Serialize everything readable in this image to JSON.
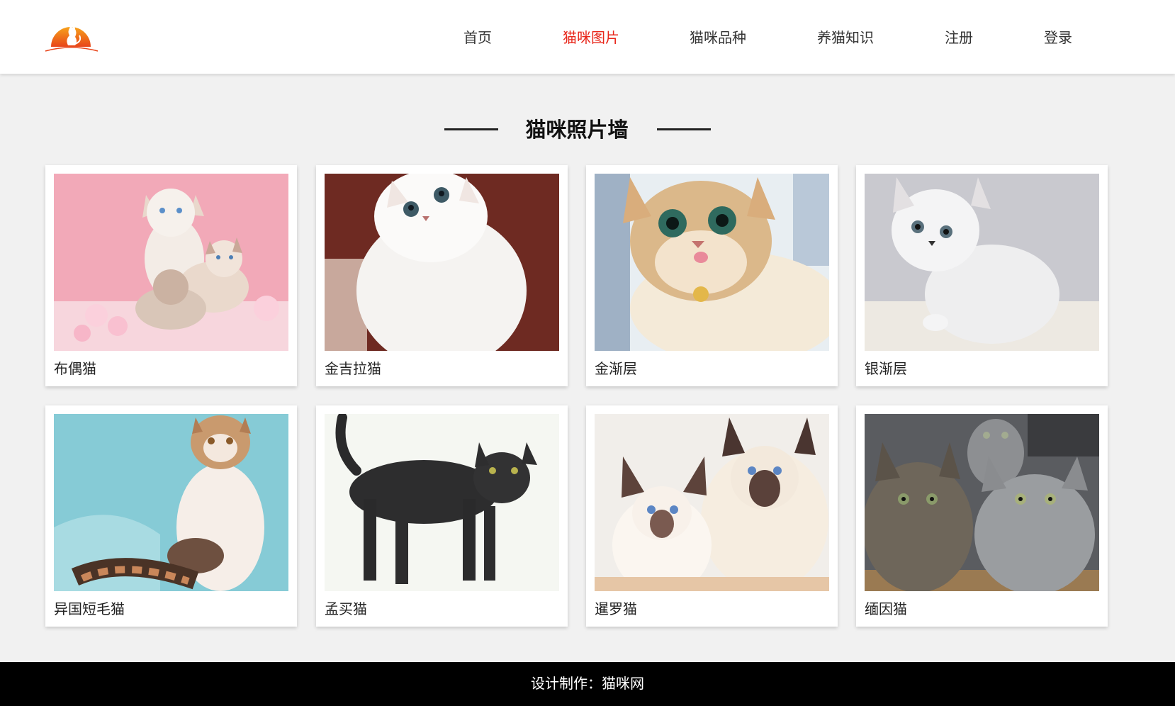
{
  "header": {
    "logo_icon": "cat-sunset-logo",
    "accent_color": "#e8261a",
    "nav": [
      {
        "label": "首页",
        "active": false
      },
      {
        "label": "猫咪图片",
        "active": true
      },
      {
        "label": "猫咪品种",
        "active": false
      },
      {
        "label": "养猫知识",
        "active": false
      },
      {
        "label": "注册",
        "active": false
      },
      {
        "label": "登录",
        "active": false
      }
    ]
  },
  "main": {
    "section_title": "猫咪照片墙",
    "cards": [
      {
        "caption": "布偶猫",
        "photo": "ragdoll-cats-photo"
      },
      {
        "caption": "金吉拉猫",
        "photo": "chinchilla-cat-photo"
      },
      {
        "caption": "金渐层",
        "photo": "golden-shaded-cat-photo"
      },
      {
        "caption": "银渐层",
        "photo": "silver-shaded-cat-photo"
      },
      {
        "caption": "异国短毛猫",
        "photo": "exotic-shorthair-cat-photo"
      },
      {
        "caption": "孟买猫",
        "photo": "bombay-cat-photo"
      },
      {
        "caption": "暹罗猫",
        "photo": "siamese-cats-photo"
      },
      {
        "caption": "缅因猫",
        "photo": "maine-coon-cats-photo"
      }
    ]
  },
  "footer": {
    "text": "设计制作：猫咪网"
  }
}
